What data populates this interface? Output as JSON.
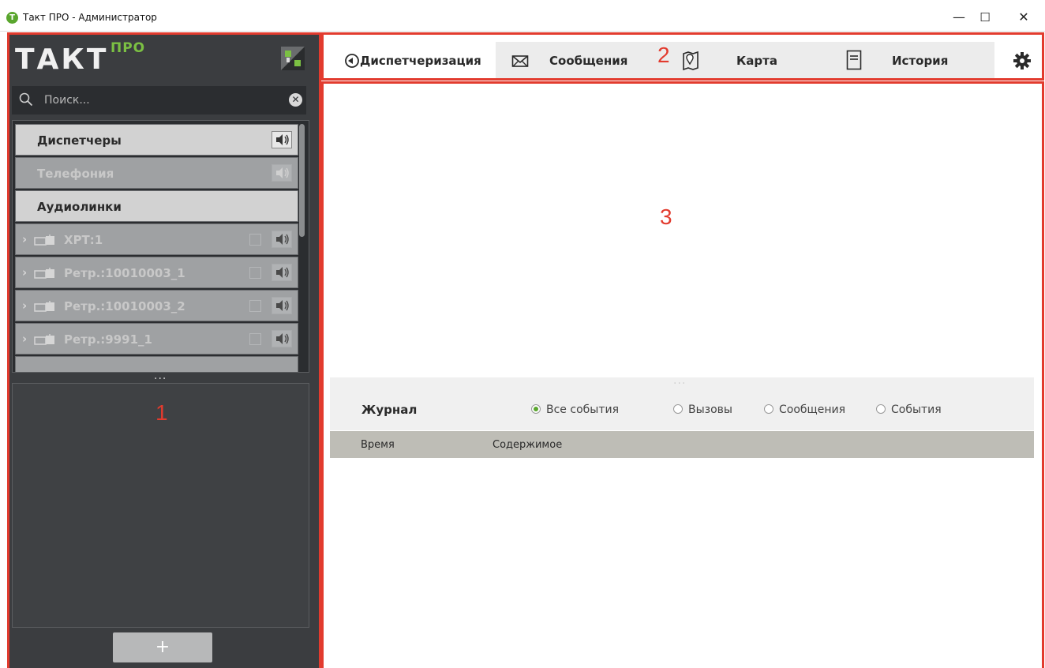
{
  "window": {
    "title": "Такт ПРО - Администратор",
    "app_icon_letter": "T",
    "controls": {
      "minimize": "—",
      "maximize": "☐",
      "close": "✕"
    }
  },
  "logo": {
    "main": "ТАКТ",
    "superscript": "ПРО"
  },
  "search": {
    "placeholder": "Поиск...",
    "value": ""
  },
  "list": {
    "rows": [
      {
        "label": "Диспетчеры",
        "style": "bright",
        "speaker": true
      },
      {
        "label": "Телефония",
        "style": "dim-text",
        "speaker": true
      },
      {
        "label": "Аудиолинки",
        "style": "bright",
        "speaker": false
      },
      {
        "label": "ХРТ:1",
        "style": "dim",
        "speaker": true,
        "expandable": true
      },
      {
        "label": "Ретр.:10010003_1",
        "style": "dim",
        "speaker": true,
        "expandable": true
      },
      {
        "label": "Ретр.:10010003_2",
        "style": "dim",
        "speaker": true,
        "expandable": true
      },
      {
        "label": "Ретр.:9991_1",
        "style": "dim",
        "speaker": true,
        "expandable": true
      }
    ]
  },
  "splitter": {
    "dots": "..."
  },
  "add_button_label": "+",
  "annotations": {
    "one": "1",
    "two": "2",
    "three": "3"
  },
  "tabs": [
    {
      "label": "Диспетчеризация",
      "icon": "dispatch-icon",
      "active": true
    },
    {
      "label": "Сообщения",
      "icon": "envelope-icon",
      "active": false
    },
    {
      "label": "Карта",
      "icon": "map-icon",
      "active": false
    },
    {
      "label": "История",
      "icon": "document-icon",
      "active": false
    }
  ],
  "settings_icon": "gear-icon",
  "journal": {
    "title": "Журнал",
    "filters": [
      {
        "label": "Все события",
        "checked": true
      },
      {
        "label": "Вызовы",
        "checked": false
      },
      {
        "label": "Сообщения",
        "checked": false
      },
      {
        "label": "События",
        "checked": false
      }
    ],
    "columns": [
      "Время",
      "Содержимое"
    ]
  },
  "colors": {
    "accent_green": "#5aa62e",
    "annotation_red": "#e23b2e",
    "panel_dark": "#3b3d40",
    "header_gray": "#bebdb6"
  }
}
